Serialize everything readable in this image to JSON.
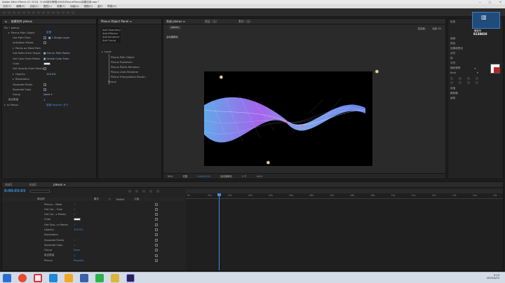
{
  "window": {
    "title": "Adobe After Effects CC 2018 - E:\\AE新手教程\\0004\\PlexusPlexus效果应用.aep *",
    "min": "—",
    "max": "□",
    "close": "✕"
  },
  "menu": [
    "文件(F)",
    "编辑(E)",
    "合成(C)",
    "图层(L)",
    "效果(T)",
    "动画(A)",
    "视图(V)",
    "窗口",
    "帮助(H)"
  ],
  "effect_controls": {
    "tab_label": "效果控件 plexus",
    "layer_path": "Plx • plexus",
    "rows": [
      {
        "indent": 1,
        "twirl": true,
        "label": "Plexus Path Object",
        "value": "重置",
        "color": "#3c8ee2"
      },
      {
        "indent": 2,
        "label": "Use Path From",
        "value": "■ 1.Shape Layer",
        "chk": true
      },
      {
        "indent": 2,
        "label": "Individual Masks",
        "chk": true
      },
      {
        "indent": 2,
        "twirl": true,
        "label": "Points on Mask Path"
      },
      {
        "indent": 2,
        "label": "Get Paths From Shape",
        "value": "■ Get on Path Points"
      },
      {
        "indent": 2,
        "label": "Get Color From Masks",
        "value": "■ Stroke Color From"
      },
      {
        "indent": 2,
        "label": "Color",
        "swatch": true
      },
      {
        "indent": 2,
        "label": "Get Opacity From Masks",
        "chk": true
      },
      {
        "indent": 2,
        "twirl": true,
        "label": "Opacity",
        "value": "100.0%"
      },
      {
        "indent": 2,
        "twirl": true,
        "label": "Replication"
      },
      {
        "indent": 2,
        "label": "Separate Points",
        "chk": true
      },
      {
        "indent": 2,
        "label": "Separate Caps",
        "chk": true
      },
      {
        "indent": 2,
        "label": "Group",
        "value": "None ▾"
      },
      {
        "indent": 1,
        "label": "组合数量",
        "value": "1"
      },
      {
        "indent": 0,
        "twirl": true,
        "label": "fx Plexus",
        "value": "重置  Register  关于",
        "color": "#3c8ee2"
      }
    ]
  },
  "plexus_panel": {
    "tab_label": "Plexus Object Panel ≡",
    "menu_items": [
      "Add Geometry",
      "Add Effector",
      "Add Renderer",
      "Add Group"
    ],
    "tree_root": "Layer",
    "tree_items": [
      "Plexus Path Object",
      "Plexus Transform",
      "Plexus Points Renderer",
      "Plexus Lines Renderer",
      "Plexus Triangulation Rende...",
      "Plexus"
    ]
  },
  "composition": {
    "tabs": [
      "合成 plexus ≡",
      "图层（无）",
      "素材（无）"
    ],
    "comp_name": "plexus",
    "info_label": "活动摄像机",
    "renderer_label": "渲染器：",
    "renderer_value": "经典 3D",
    "footer": [
      "50%",
      "完整",
      "0:00:03:03",
      "活动摄像机",
      "1 个",
      "+0.0"
    ]
  },
  "right_panel": {
    "items": [
      "信息",
      "音频",
      "预览",
      "效果和预设",
      "对齐",
      "库",
      "字符",
      "段落",
      "跟踪器",
      "画笔"
    ],
    "watermark_line1": "微信号",
    "watermark_line2": "8138828",
    "font_label": "微软雅黑",
    "font_style": "Bold"
  },
  "timeline": {
    "tabs": [
      "合成1",
      "合成2",
      "plexus ≡"
    ],
    "timecode": "0:00:03:03",
    "columns": [
      "源名称",
      "模式",
      "T",
      "TrkMat",
      "父级"
    ],
    "rows": [
      {
        "label": "Plexus... Mask",
        "value": "✓"
      },
      {
        "label": "Get Col... Fuse",
        "value": "✓"
      },
      {
        "label": "Get Col...s Masks",
        "value": "✓"
      },
      {
        "label": "Color",
        "swatch": true
      },
      {
        "label": "Get Opa...m Masks",
        "value": "✓"
      },
      {
        "label": "Opacity",
        "value": "100.0%"
      },
      {
        "label": "Replication",
        "value": ""
      },
      {
        "label": "Separate Points",
        "value": "✓"
      },
      {
        "label": "Separate Caps",
        "value": "✓"
      },
      {
        "label": "Group",
        "value": "None"
      },
      {
        "label": "组合数量",
        "value": "1"
      },
      {
        "label": "Plexus",
        "value": "Register"
      }
    ],
    "ruler": [
      "0s",
      "01s",
      "02s",
      "03s",
      "04s",
      "05s",
      "06s",
      "07s",
      "08s",
      "09s",
      "10s",
      "11s",
      "12s",
      "13s",
      "14s",
      "15s"
    ],
    "playhead_fraction": 0.105
  },
  "taskbar": {
    "time": "9:13",
    "date": "2019/4/23",
    "apps": [
      "start",
      "firefox",
      "chrome",
      "files",
      "media",
      "word",
      "edge",
      "explorer",
      "aftereffects"
    ]
  },
  "colors": {
    "accent": "#3c8ee2",
    "ae_purple": "#9999ff",
    "ribbon1": "#6bb6ff",
    "ribbon2": "#b36bff"
  }
}
